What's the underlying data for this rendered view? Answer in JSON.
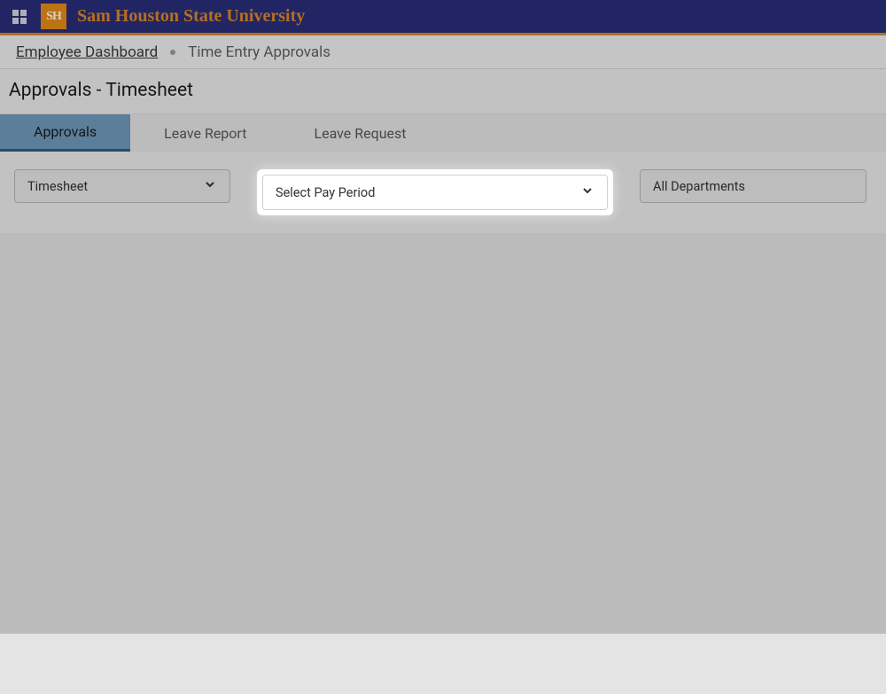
{
  "banner": {
    "logo_text": "SH",
    "university_name": "Sam Houston State University"
  },
  "breadcrumb": {
    "home": "Employee Dashboard",
    "current": "Time Entry Approvals"
  },
  "page_title": "Approvals - Timesheet",
  "tabs": {
    "approvals": "Approvals",
    "leave_report": "Leave Report",
    "leave_request": "Leave Request"
  },
  "filters": {
    "timesheet": "Timesheet",
    "pay_period": "Select Pay Period",
    "departments": "All Departments"
  }
}
